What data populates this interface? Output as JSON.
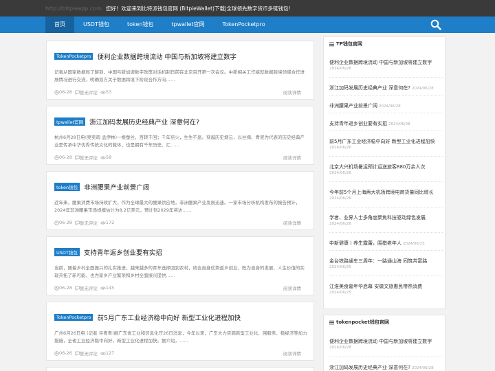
{
  "topbar": {
    "site": "http://bitpieapp.com",
    "welcome": "您好！欢迎来到比特派钱包官网 (BitpieWallet)下载|全球领先数字货币多链钱包!"
  },
  "nav": {
    "items": [
      "首页",
      "USDT钱包",
      "token钱包",
      "tpwallet官网",
      "TokenPocketpro"
    ]
  },
  "icons": {
    "search": "search-icon",
    "comment": "comment-icon",
    "views": "eye-icon",
    "clock": "clock-icon",
    "list": "list-icon"
  },
  "colors": {
    "brand": "#1e7ec8",
    "topbar": "#3a3a3a",
    "nav_active": "#16629e"
  },
  "posts": [
    {
      "badge": "TokenPocketpro",
      "title": "便利企业数据跨境流动 中国与新加坡将建立数字",
      "excerpt": "记者从国家数据局了解到，中国与新加坡数字政策对话机制日前在北京召开第一次会议。中新相关工作组就数据跨境领域合作进展情况进行交流，明确双方关于数据跨境下阶段合作方向……",
      "date": "06-28",
      "comments": "暂无评论",
      "views": "53",
      "more": "阅读详情"
    },
    {
      "badge": "tpwallet官网",
      "title": "浙江加码发展历史经典产业 深意何在?",
      "excerpt": "杭州6月28日电(吴奕萌 孟伊林)一根蚕丝，百转千回；千年窑火，生生不息。穿越历史烟云，以丝绸、青瓷为代表的历史经典产业是传承中华优秀传统文化的载体，也是拥有千年历史、汇……",
      "date": "06-28",
      "comments": "暂无评论",
      "views": "58",
      "more": "阅读详情"
    },
    {
      "badge": "token钱包",
      "title": "非洲腰果产业前景广阔",
      "excerpt": "近年来，腰果消费市场持续扩大，作为全球最大的腰果供应地，非洲腰果产业发展迅速。一家市场分析机构发布的报告预计，2024年非洲腰果市场规模估计为8.2亿美元，预计到2029年将达……",
      "date": "06-28",
      "comments": "暂无评论",
      "views": "172",
      "more": "阅读详情"
    },
    {
      "badge": "USDT钱包",
      "title": "支持青年返乡创业要有实招",
      "excerpt": "当前，随着乡村全面振兴的扎实推进，越来越多的青年选择回到农村，结合自身优势返乡创业，既为自身的发展、人生价值的实现开拓了新可能，也为家乡产业繁荣和乡村全面振兴提供……",
      "date": "06-28",
      "comments": "暂无评论",
      "views": "145",
      "more": "阅读详情"
    },
    {
      "badge": "TokenPocketpro",
      "title": "前5月广东工业经济稳中向好 新型工业化进程加快",
      "excerpt": "广州6月26日电 (记者 许青青)据广东省工业和信息化厅26日消息，今年以来，广东大力实施新型工业化、强服务、稳经济等加力措施，全省工业经济稳中向好，新型工业化进程加快。据介绍，……",
      "date": "06-26",
      "comments": "暂无评论",
      "views": "127",
      "more": "阅读详情"
    }
  ],
  "widgets": [
    {
      "title": "TP钱包官网",
      "items": [
        {
          "text": "便利企业数据跨境流动 中国与新加坡将建立数字",
          "date": "2024/06/28"
        },
        {
          "text": "浙江加码发展历史经典产业 深意何在?",
          "date": "2024/06/28"
        },
        {
          "text": "非洲腰果产业前景广阔",
          "date": "2024/06/28"
        },
        {
          "text": "支持青年返乡创业要有实招",
          "date": "2024/06/28"
        },
        {
          "text": "前5月广东工业经济稳中向好 新型工业化进程加快",
          "date": "2024/06/26"
        },
        {
          "text": "北京大兴机场暑运预计运送旅客880万余人次",
          "date": "2024/06/26"
        },
        {
          "text": "今年前5个月上海两大机场跨境电商货量同比增长",
          "date": "2024/06/26"
        },
        {
          "text": "学者、业界人士多角度聚焦科技驱动绿色发展",
          "date": "2024/06/26"
        },
        {
          "text": "中新健康丨养生露蕾，围猎老年人",
          "date": "2024/06/25"
        },
        {
          "text": "金台铁路通车三周年：一路通山海 同筑共富路",
          "date": "2024/06/25"
        },
        {
          "text": "江淮美食嘉年华启幕 安徽文旅惠民带热消费",
          "date": "2024/06/25"
        }
      ]
    },
    {
      "title": "tokenpocket钱包官网",
      "items": [
        {
          "text": "便利企业数据跨境流动 中国与新加坡将建立数字",
          "date": "2024/06/28"
        },
        {
          "text": "浙江加码发展历史经典产业 深意何在?",
          "date": "2024/06/28"
        }
      ]
    }
  ]
}
